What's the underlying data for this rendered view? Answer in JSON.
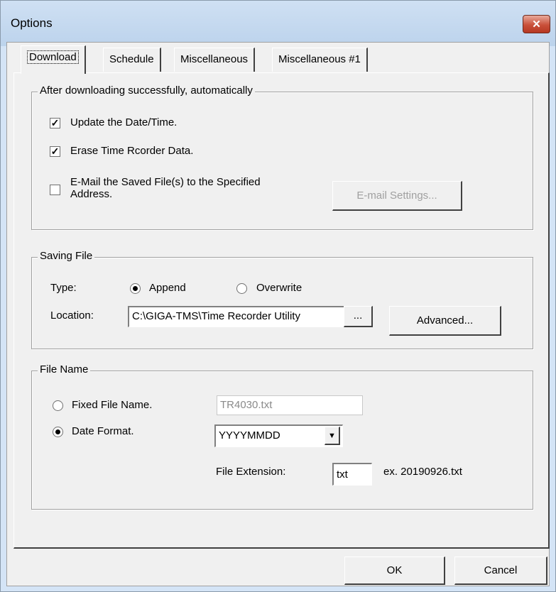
{
  "window": {
    "title": "Options",
    "close_glyph": "✕"
  },
  "tabs": [
    {
      "label": "Download"
    },
    {
      "label": "Schedule"
    },
    {
      "label": "Miscellaneous"
    },
    {
      "label": "Miscellaneous #1"
    }
  ],
  "after_download": {
    "group_label": "After downloading successfully, automatically",
    "update_datetime": {
      "label": "Update the Date/Time.",
      "checked": true
    },
    "erase_data": {
      "label": "Erase Time Rcorder Data.",
      "checked": true
    },
    "email_files": {
      "label_line1": "E-Mail the Saved File(s) to the Specified",
      "label_line2": "Address.",
      "checked": false
    },
    "email_settings_button": "E-mail Settings..."
  },
  "saving_file": {
    "group_label": "Saving File",
    "type_label": "Type:",
    "append_label": "Append",
    "overwrite_label": "Overwrite",
    "selected_type": "Append",
    "location_label": "Location:",
    "location_value": "C:\\GIGA-TMS\\Time Recorder Utility",
    "browse_button": "...",
    "advanced_button": "Advanced..."
  },
  "file_name": {
    "group_label": "File Name",
    "fixed_label": "Fixed File Name.",
    "fixed_value": "TR4030.txt",
    "date_format_label": "Date Format.",
    "date_format_value": "YYYYMMDD",
    "selected_option": "Date Format.",
    "extension_label": "File Extension:",
    "extension_value": "txt",
    "example_text": "ex. 20190926.txt"
  },
  "footer": {
    "ok_button": "OK",
    "cancel_button": "Cancel"
  }
}
